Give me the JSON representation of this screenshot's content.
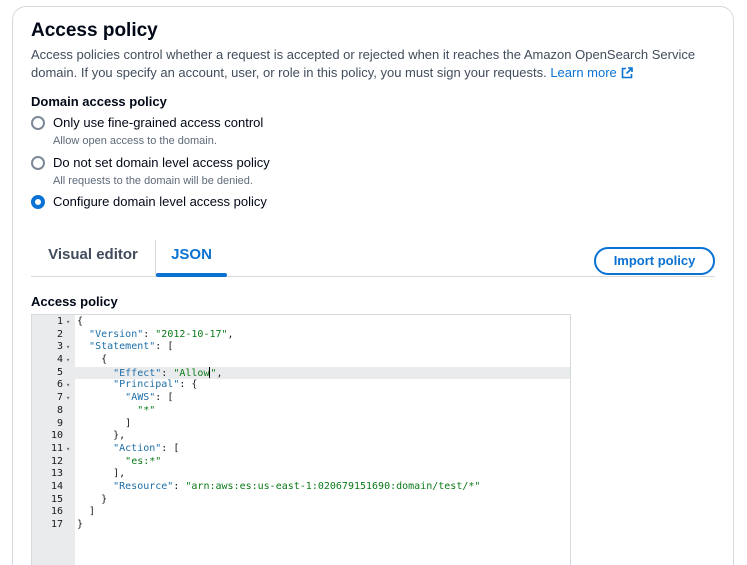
{
  "section": {
    "title": "Access policy",
    "description": "Access policies control whether a request is accepted or rejected when it reaches the Amazon OpenSearch Service domain. If you specify an account, user, or role in this policy, you must sign your requests.",
    "learn_more": "Learn more"
  },
  "domain_access": {
    "label": "Domain access policy",
    "options": [
      {
        "label": "Only use fine-grained access control",
        "description": "Allow open access to the domain.",
        "selected": false
      },
      {
        "label": "Do not set domain level access policy",
        "description": "All requests to the domain will be denied.",
        "selected": false
      },
      {
        "label": "Configure domain level access policy",
        "description": "",
        "selected": true
      }
    ]
  },
  "tabs": [
    {
      "label": "Visual editor",
      "active": false
    },
    {
      "label": "JSON",
      "active": true
    }
  ],
  "import_button": "Import policy",
  "editor": {
    "label": "Access policy",
    "active_line": 5,
    "lines": [
      {
        "n": "1",
        "fold": true,
        "text": "{"
      },
      {
        "n": "2",
        "fold": false,
        "text": "  \"Version\": \"2012-10-17\","
      },
      {
        "n": "3",
        "fold": true,
        "text": "  \"Statement\": ["
      },
      {
        "n": "4",
        "fold": true,
        "text": "    {"
      },
      {
        "n": "5",
        "fold": false,
        "text": "      \"Effect\": \"Allow\","
      },
      {
        "n": "6",
        "fold": true,
        "text": "      \"Principal\": {"
      },
      {
        "n": "7",
        "fold": true,
        "text": "        \"AWS\": ["
      },
      {
        "n": "8",
        "fold": false,
        "text": "          \"*\""
      },
      {
        "n": "9",
        "fold": false,
        "text": "        ]"
      },
      {
        "n": "10",
        "fold": false,
        "text": "      },"
      },
      {
        "n": "11",
        "fold": true,
        "text": "      \"Action\": ["
      },
      {
        "n": "12",
        "fold": false,
        "text": "        \"es:*\""
      },
      {
        "n": "13",
        "fold": false,
        "text": "      ],"
      },
      {
        "n": "14",
        "fold": false,
        "text": "      \"Resource\": \"arn:aws:es:us-east-1:020679151690:domain/test/*\""
      },
      {
        "n": "15",
        "fold": false,
        "text": "    }"
      },
      {
        "n": "16",
        "fold": false,
        "text": "  ]"
      },
      {
        "n": "17",
        "fold": false,
        "text": "}"
      }
    ]
  },
  "colors": {
    "accent": "#0972d3",
    "json_key": "#1d6ea8",
    "json_string": "#0a7a18"
  }
}
